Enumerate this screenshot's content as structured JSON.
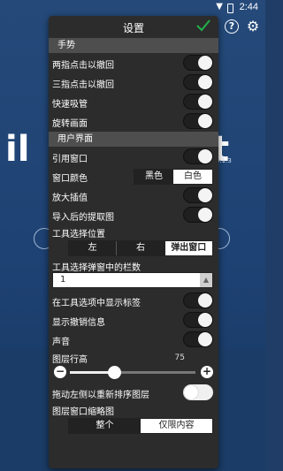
{
  "status": {
    "time": "2:44"
  },
  "background": {
    "logo_left": "il",
    "logo_right": "t",
    "version": "0.1.3"
  },
  "panel": {
    "title": "设置",
    "sections": {
      "gesture": "手势",
      "ui": "用户界面"
    },
    "gesture_rows": [
      {
        "label": "两指点击以撤回",
        "on": true
      },
      {
        "label": "三指点击以撤回",
        "on": true
      },
      {
        "label": "快速吸管",
        "on": true
      },
      {
        "label": "旋转画面",
        "on": true
      }
    ],
    "ref_window": {
      "label": "引用窗口",
      "on": true
    },
    "window_color": {
      "label": "窗口颜色",
      "options": [
        "黑色",
        "白色"
      ],
      "selected": "黑色"
    },
    "zoom_interp": {
      "label": "放大插值",
      "on": true
    },
    "post_import": {
      "label": "导入后的提取图",
      "on": true
    },
    "tool_position": {
      "label": "工具选择位置",
      "options": [
        "左",
        "右",
        "弹出窗口"
      ],
      "selected": "弹出窗口"
    },
    "tool_columns": {
      "label": "工具选择弹窗中的栏数",
      "value": "1"
    },
    "show_labels": {
      "label": "在工具选项中显示标签",
      "on": true
    },
    "show_undo": {
      "label": "显示撤销信息",
      "on": true
    },
    "sound": {
      "label": "声音",
      "on": true
    },
    "layer_height": {
      "label": "图层行高",
      "value": "75",
      "fraction": 0.35
    },
    "drag_reorder": {
      "label": "拖动左侧以重新排序图层",
      "on": false
    },
    "layer_thumb": {
      "label": "图层窗口缩略图",
      "options": [
        "整个",
        "仅限内容"
      ],
      "selected": "整个"
    }
  },
  "colors": {
    "accent": "#22b04a",
    "panel": "#2c2c2c",
    "section": "#4e4e4e"
  }
}
